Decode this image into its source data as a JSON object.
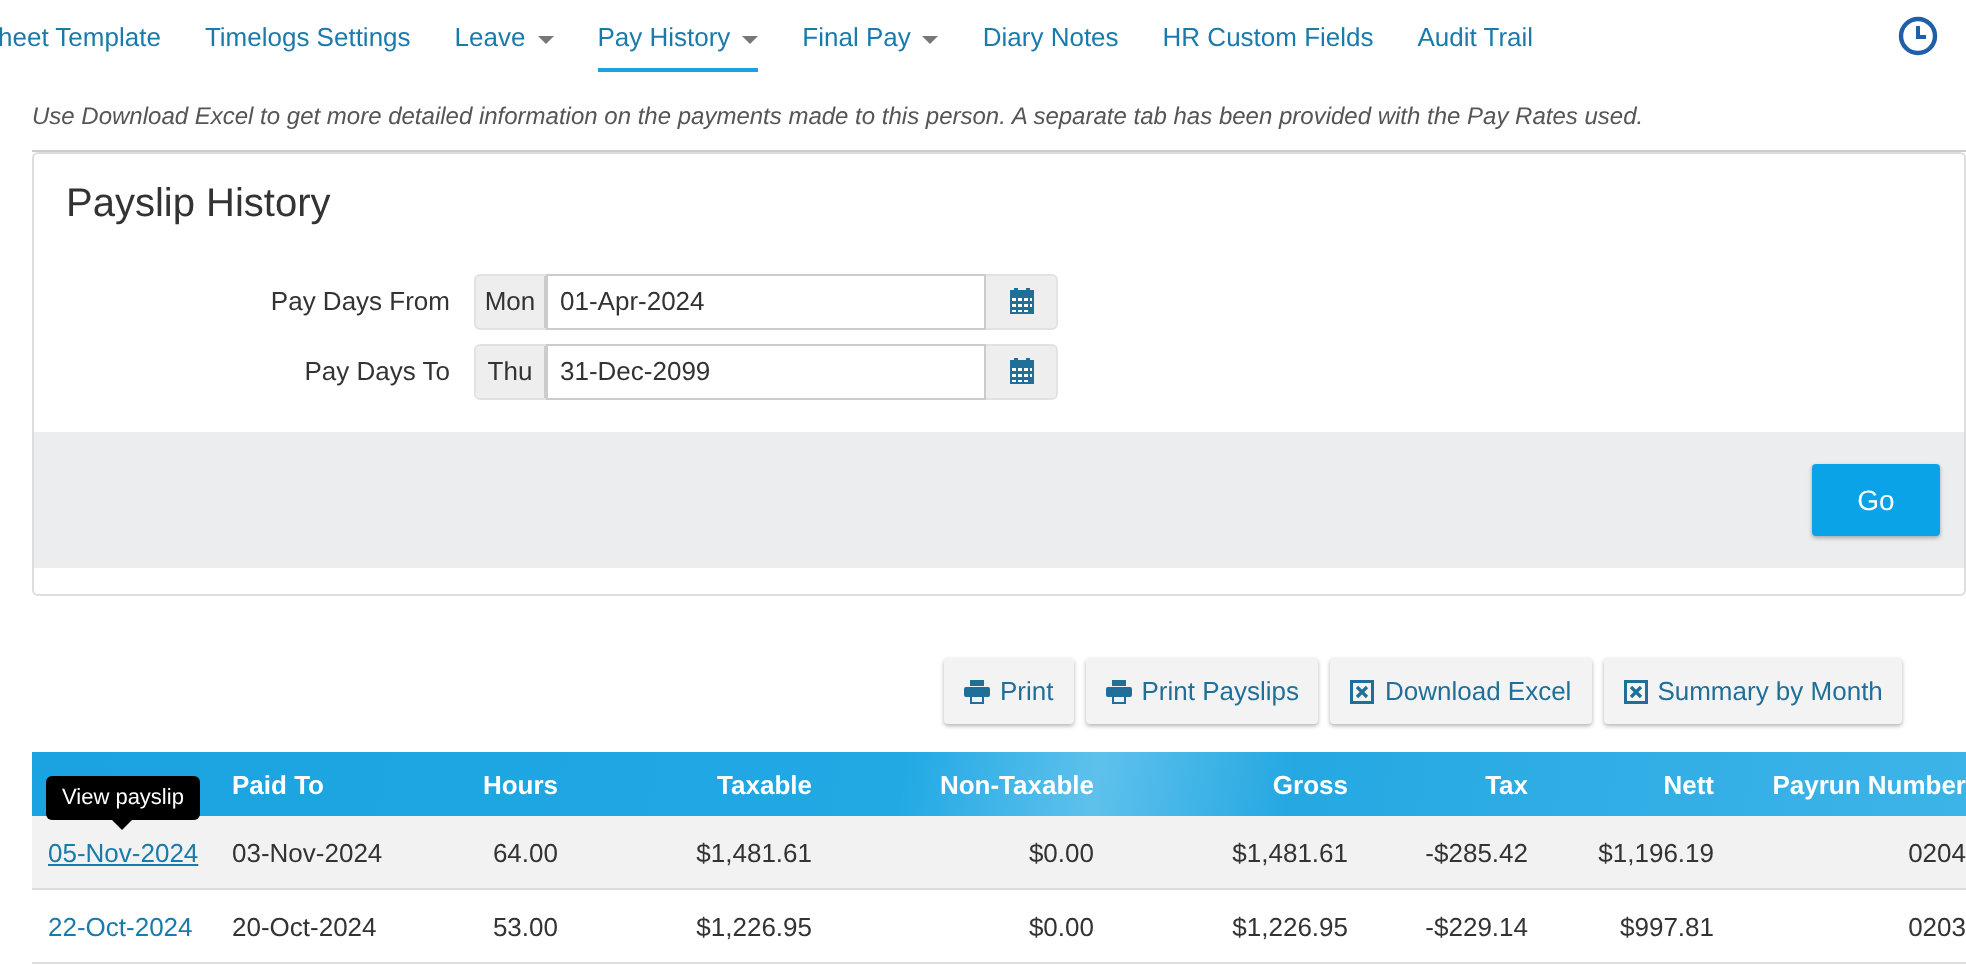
{
  "nav": {
    "items": [
      {
        "label": "heet Template",
        "kind": "link",
        "selected": false
      },
      {
        "label": "Timelogs Settings",
        "kind": "link",
        "selected": false
      },
      {
        "label": "Leave",
        "kind": "dropdown",
        "selected": false
      },
      {
        "label": "Pay History",
        "kind": "dropdown",
        "selected": true
      },
      {
        "label": "Final Pay",
        "kind": "dropdown",
        "selected": false
      },
      {
        "label": "Diary Notes",
        "kind": "link",
        "selected": false
      },
      {
        "label": "HR Custom Fields",
        "kind": "link",
        "selected": false
      },
      {
        "label": "Audit Trail",
        "kind": "link",
        "selected": false
      }
    ]
  },
  "note": "Use Download Excel to get more detailed information on the payments made to this person. A separate tab has been provided with the Pay Rates used.",
  "panel": {
    "title": "Payslip History",
    "fields": [
      {
        "label": "Pay Days From",
        "day": "Mon",
        "value": "01-Apr-2024"
      },
      {
        "label": "Pay Days To",
        "day": "Thu",
        "value": "31-Dec-2099"
      }
    ],
    "go_button": "Go"
  },
  "actions": [
    {
      "label": "Print",
      "kind": "print"
    },
    {
      "label": "Print Payslips",
      "kind": "print"
    },
    {
      "label": "Download Excel",
      "kind": "excel"
    },
    {
      "label": "Summary by Month",
      "kind": "excel"
    }
  ],
  "table": {
    "columns": [
      "",
      "Paid To",
      "Hours",
      "Taxable",
      "Non-Taxable",
      "Gross",
      "Tax",
      "Nett",
      "Payrun Number"
    ],
    "tooltip": "View payslip",
    "rows": [
      {
        "highlighted": true,
        "cells": [
          "05-Nov-2024",
          "03-Nov-2024",
          "64.00",
          "$1,481.61",
          "$0.00",
          "$1,481.61",
          "-$285.42",
          "$1,196.19",
          "0204"
        ]
      },
      {
        "highlighted": false,
        "cells": [
          "22-Oct-2024",
          "20-Oct-2024",
          "53.00",
          "$1,226.95",
          "$0.00",
          "$1,226.95",
          "-$229.14",
          "$997.81",
          "0203"
        ]
      }
    ]
  }
}
